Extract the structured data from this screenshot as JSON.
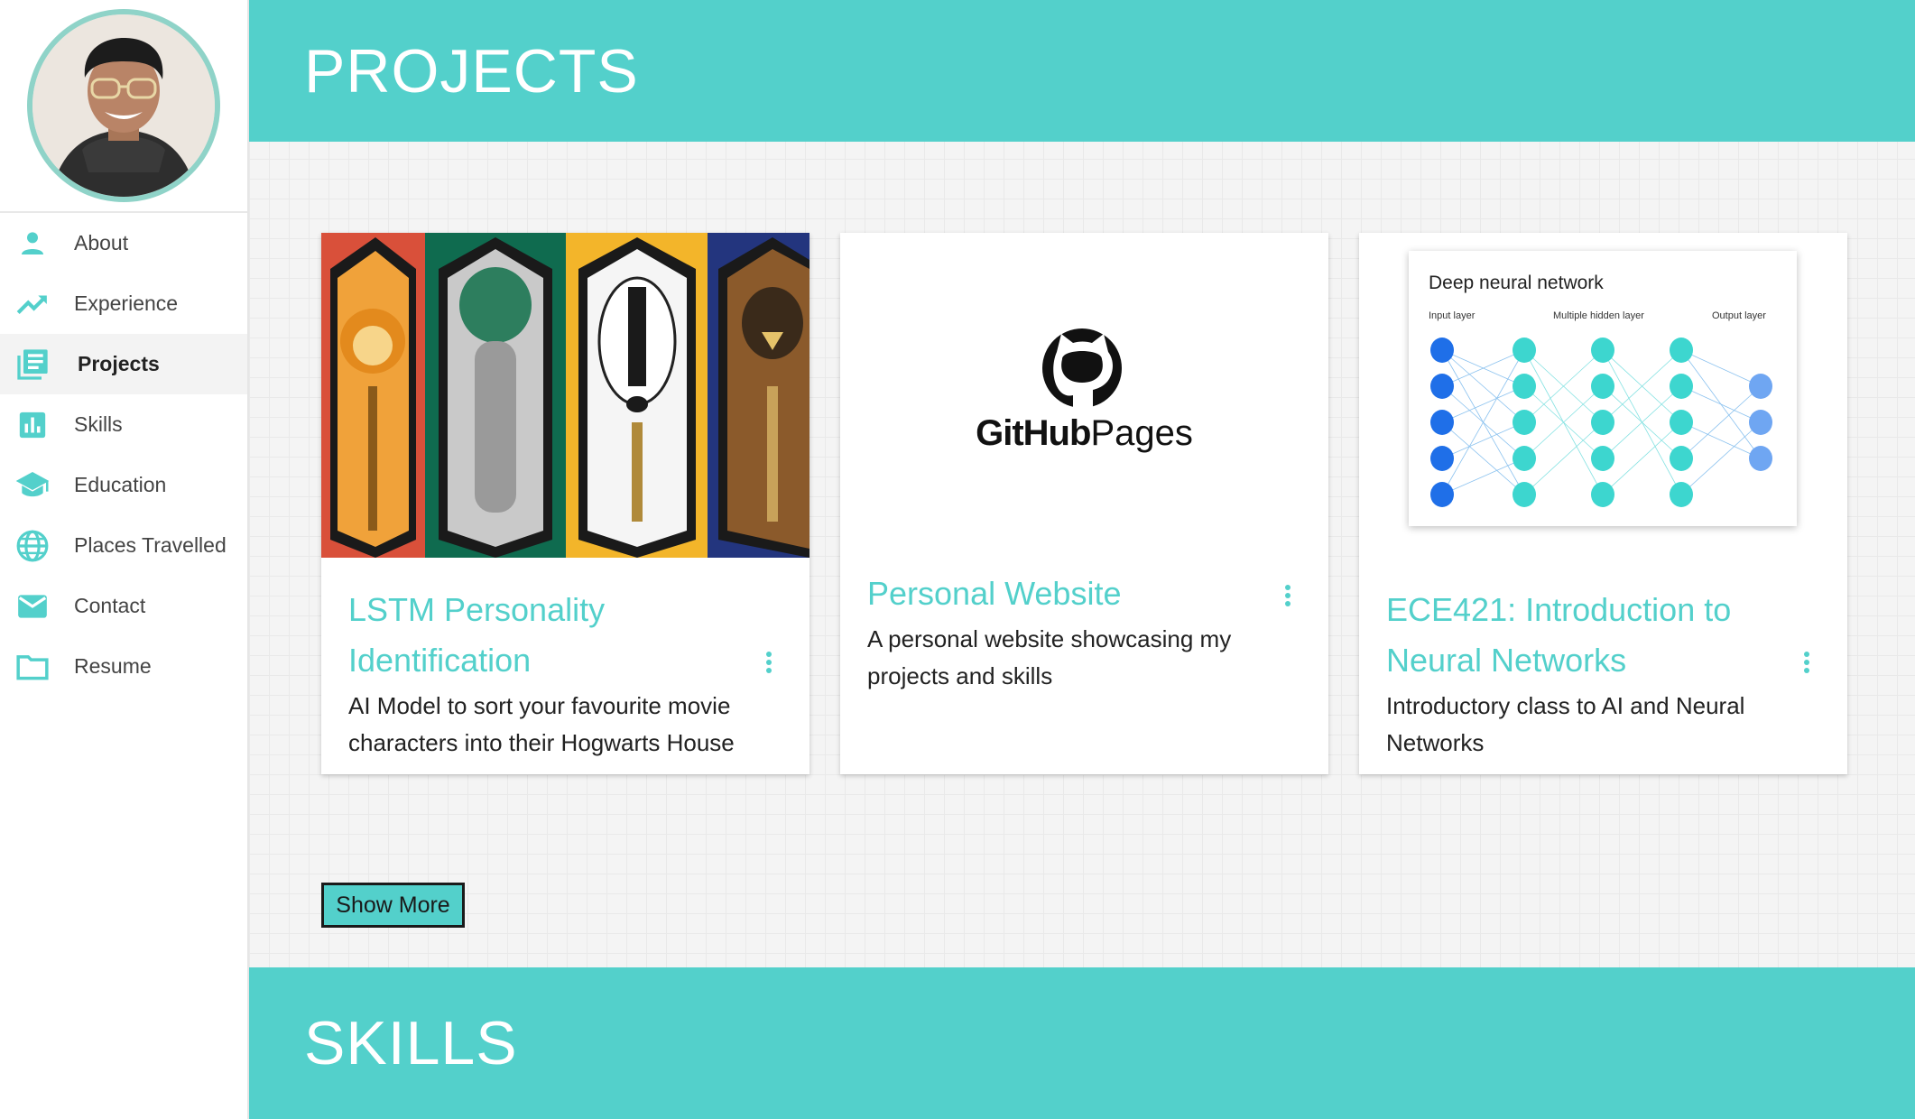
{
  "sidebar": {
    "items": [
      {
        "label": "About",
        "icon": "person-icon"
      },
      {
        "label": "Experience",
        "icon": "trending-up-icon"
      },
      {
        "label": "Projects",
        "icon": "library-books-icon"
      },
      {
        "label": "Skills",
        "icon": "bar-chart-icon"
      },
      {
        "label": "Education",
        "icon": "graduation-cap-icon"
      },
      {
        "label": "Places Travelled",
        "icon": "globe-icon"
      },
      {
        "label": "Contact",
        "icon": "mail-icon"
      },
      {
        "label": "Resume",
        "icon": "folder-icon"
      }
    ],
    "active": "Projects"
  },
  "sections": {
    "projects_title": "PROJECTS",
    "skills_title": "SKILLS"
  },
  "projects": [
    {
      "title": "LSTM Personality Identification",
      "description": "AI Model to sort your favourite movie characters into their Hogwarts House"
    },
    {
      "title": "Personal Website",
      "description": "A personal website showcasing my projects and skills"
    },
    {
      "title": "ECE421: Introduction to Neural Networks",
      "description": "Introductory class to AI and Neural Networks"
    }
  ],
  "media": {
    "github_logo_left": "GitHub",
    "github_logo_right": "Pages",
    "nn_title": "Deep neural network",
    "nn_input": "Input layer",
    "nn_hidden": "Multiple hidden layer",
    "nn_output": "Output layer"
  },
  "show_more_label": "Show More",
  "colors": {
    "accent": "#53d0cb",
    "avatar_ring": "#8fd3c8"
  }
}
